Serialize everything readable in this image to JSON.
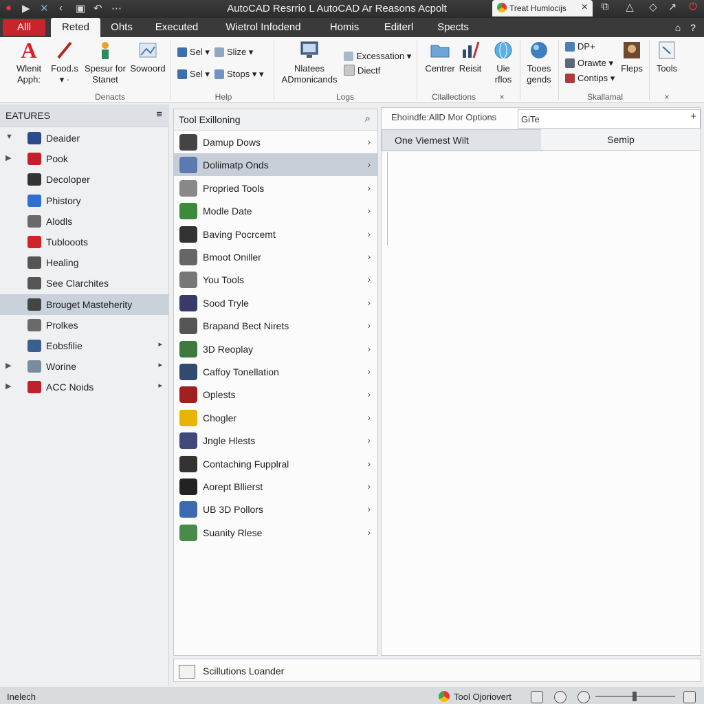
{
  "window": {
    "title": "AutoCAD Resrrio L AutoCAD Ar Reasons Acpolt",
    "browser_tab": "Treat Humlocijs",
    "user_icon": "user-icon",
    "help_icon": "help-icon"
  },
  "ribbon_tabs": {
    "app_button": "Alll",
    "items": [
      "Reted",
      "Ohts",
      "Executed",
      "Wietrol Infodend",
      "Homis",
      "Editerl",
      "Spects"
    ]
  },
  "ribbon": {
    "panel_labels": [
      "Denacts",
      "Help",
      "Logs",
      "Cllallections",
      "Skallamal"
    ],
    "big_buttons": [
      {
        "label": "Wlenit\nApph:"
      },
      {
        "label": "Food.s\n▾ ·"
      },
      {
        "label": "Spesur for\nStanet"
      },
      {
        "label": "Sowoord"
      },
      {
        "label": "Nlatees\nADmonicands"
      },
      {
        "label": "Centrer"
      },
      {
        "label": "Reisit"
      },
      {
        "label": "Uie\nrflos"
      },
      {
        "label": "Tooes\ngends"
      },
      {
        "label": "Fleps"
      },
      {
        "label": "Tools"
      }
    ],
    "small_buttons": [
      "Sel ▾",
      "Slize ▾",
      "Sel ▾",
      "Stops ▾ ▾",
      "Excessation ▾",
      "Diectf",
      "DP+",
      "Orawte ▾",
      "Contips ▾"
    ]
  },
  "features": {
    "title": "EATURES",
    "items": [
      {
        "label": "Deaider",
        "caret": "▼",
        "arrow": ""
      },
      {
        "label": "Pook",
        "caret": "▶",
        "arrow": ""
      },
      {
        "label": "Decoloper",
        "caret": "",
        "arrow": ""
      },
      {
        "label": "Phistory",
        "caret": "",
        "arrow": ""
      },
      {
        "label": "Alodls",
        "caret": "",
        "arrow": ""
      },
      {
        "label": "Tublooots",
        "caret": "",
        "arrow": ""
      },
      {
        "label": "Healing",
        "caret": "",
        "arrow": ""
      },
      {
        "label": "See Clarchites",
        "caret": "",
        "arrow": ""
      },
      {
        "label": "Brouget Masteherity",
        "caret": "",
        "arrow": ""
      },
      {
        "label": "Prolkes",
        "caret": "",
        "arrow": ""
      },
      {
        "label": "Eobsfilie",
        "caret": "",
        "arrow": "▸"
      },
      {
        "label": "Worine",
        "caret": "▶",
        "arrow": "▸"
      },
      {
        "label": "ACC Noids",
        "caret": "▶",
        "arrow": "▸"
      }
    ],
    "selected_index": 8
  },
  "tools": {
    "title": "Tool Exilloning",
    "search_icon": "search-icon",
    "items": [
      "Damup Dows",
      "Doliimatp Onds",
      "Propried Tools",
      "Modle Date",
      "Baving Pocrcemt",
      "Bmoot Oniller",
      "You Tools",
      "Sood Tryle",
      "Brapand Bect Nirets",
      "3D Reoplay",
      "Caffoy Tonellation",
      "Oplests",
      "Chogler",
      "Jngle Hlests",
      "Contaching Fupplral",
      "Aorept Bllierst",
      "UB 3D Pollors",
      "Suanity Rlese"
    ],
    "selected_index": 1
  },
  "options": {
    "header": "Ehoindfe:AllD Mor Options",
    "input_value": "GiTe",
    "tabs": [
      "One Viemest Wilt",
      "Semip"
    ]
  },
  "bottom": {
    "label": "Scillutions Loander"
  },
  "status": {
    "left": "Inelech",
    "right": "Tool Ojoriovert"
  },
  "colors": {
    "app_red": "#c8242b",
    "ribbon_dark": "#3a3a3a",
    "selection": "#c7ced8"
  }
}
